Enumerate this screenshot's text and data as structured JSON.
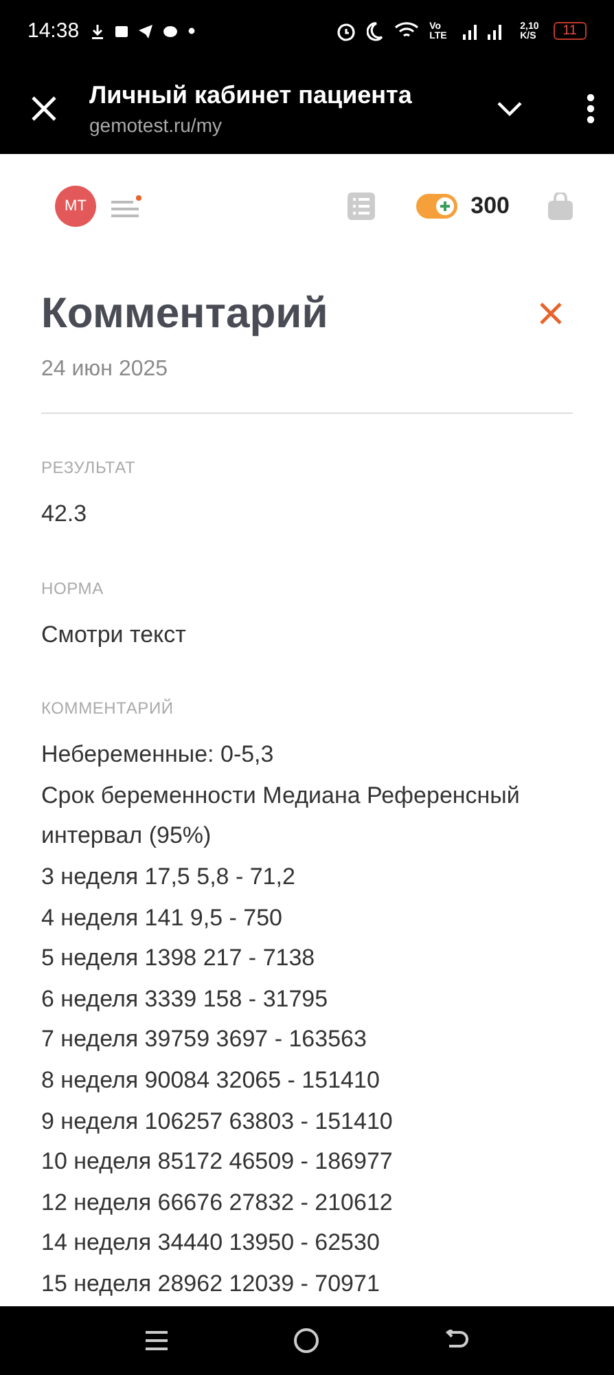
{
  "status_bar": {
    "time": "14:38",
    "volte": "Vo LTE",
    "speed": "2,10 K/S",
    "battery": "11"
  },
  "browser": {
    "title": "Личный кабинет пациента",
    "url": "gemotest.ru/my"
  },
  "header": {
    "avatar": "МТ",
    "menu_notification": true,
    "bonus_on": true,
    "bonus": "300"
  },
  "panel": {
    "title": "Комментарий",
    "date": "24 июн 2025",
    "fields": [
      {
        "label": "РЕЗУЛЬТАТ",
        "lines": [
          "42.3"
        ]
      },
      {
        "label": "НОРМА",
        "lines": [
          "Смотри текст"
        ]
      },
      {
        "label": "КОММЕНТАРИЙ",
        "lines": [
          "Небеременные: 0-5,3",
          "Срок беременности Медиана Референсный интервал (95%)",
          "3 неделя 17,5 5,8 - 71,2",
          "4 неделя 141 9,5 - 750",
          "5 неделя 1398 217 - 7138",
          "6 неделя 3339 158 - 31795",
          "7 неделя 39759 3697 - 163563",
          "8 неделя 90084 32065 - 151410",
          "9 неделя 106257 63803 - 151410",
          "10 неделя 85172 46509 - 186977",
          "12 неделя 66676 27832 - 210612",
          "14 неделя 34440 13950 - 62530",
          "15 неделя 28962 12039 - 70971"
        ]
      }
    ]
  }
}
